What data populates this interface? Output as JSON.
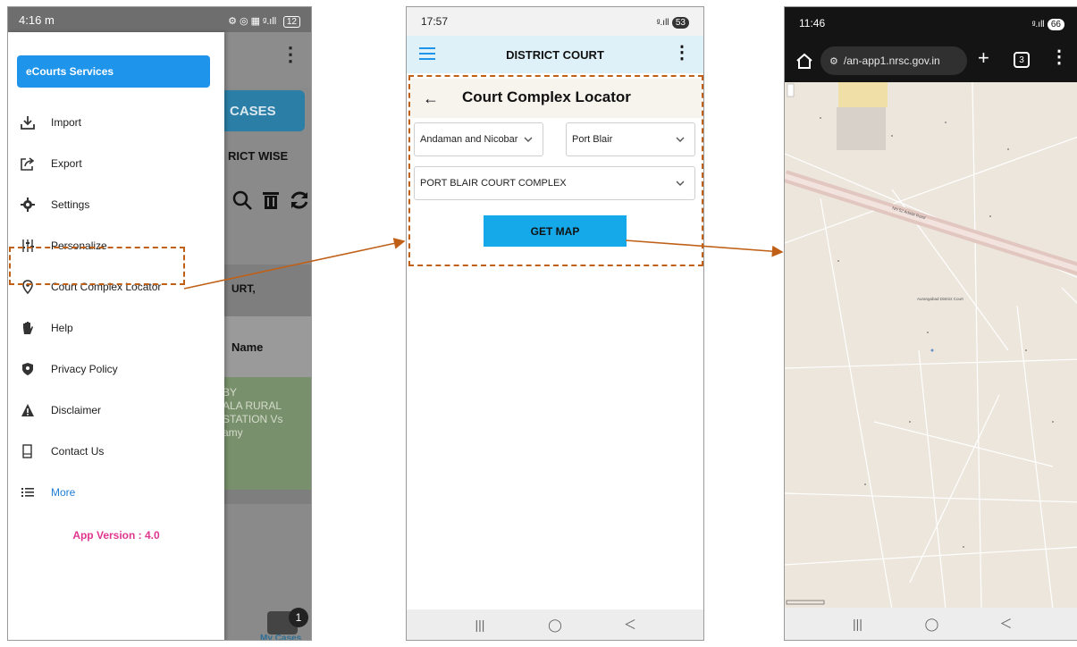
{
  "phone1": {
    "status": {
      "time": "4:16",
      "time_suffix": "m",
      "icons": "⚙ ◎ ▦ ᵍ.ıll",
      "battery": "12"
    },
    "background": {
      "cases_button": "CASES",
      "district_wise": "RICT WISE",
      "court_label": "URT,",
      "name_header": "Name",
      "case_text": "BY\nALA RURAL\nSTATION Vs\namy",
      "my_cases_badge": "1",
      "my_cases_label": "My Cases"
    },
    "drawer": {
      "title": "eCourts Services",
      "items": [
        {
          "label": "Import",
          "icon": "import-icon"
        },
        {
          "label": "Export",
          "icon": "export-icon"
        },
        {
          "label": "Settings",
          "icon": "gear-icon"
        },
        {
          "label": "Personalize",
          "icon": "sliders-icon"
        },
        {
          "label": "Court Complex Locator",
          "icon": "location-pin-icon"
        },
        {
          "label": "Help",
          "icon": "hand-icon"
        },
        {
          "label": "Privacy Policy",
          "icon": "shield-icon"
        },
        {
          "label": "Disclaimer",
          "icon": "warning-icon"
        },
        {
          "label": "Contact Us",
          "icon": "phone-icon"
        },
        {
          "label": "More",
          "icon": "list-icon"
        }
      ],
      "app_version": "App Version : 4.0"
    }
  },
  "phone2": {
    "status": {
      "time": "17:57",
      "battery": "53"
    },
    "appbar": {
      "title": "DISTRICT COURT"
    },
    "page_title": "Court Complex Locator",
    "state_select": {
      "value": "Andaman and Nicobar"
    },
    "district_select": {
      "value": "Port Blair"
    },
    "complex_select": {
      "value": "PORT BLAIR COURT COMPLEX"
    },
    "get_map_label": "GET MAP"
  },
  "phone3": {
    "status": {
      "time": "11:46",
      "battery": "66"
    },
    "url": "/an-app1.nrsc.gov.in",
    "tab_count": "3",
    "map_labels": {
      "court": "Aurangabad District Court",
      "road": "NH 52 Adalat Road"
    }
  },
  "colors": {
    "highlight_border": "#c06016",
    "drawer_title_bg": "#1e94ea",
    "get_map_bg": "#16a9ea",
    "app_version": "#e0368f",
    "more_link": "#1e7fd6"
  }
}
